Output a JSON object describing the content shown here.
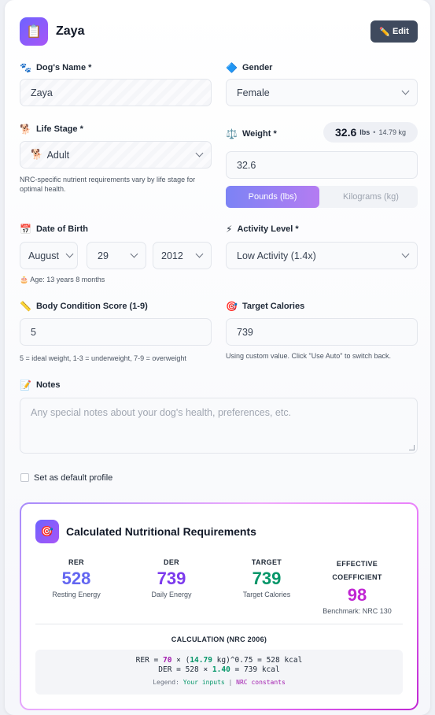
{
  "header": {
    "icon": "clipboard-icon",
    "title": "Zaya",
    "edit_label": "Edit",
    "edit_icon": "pencil-icon"
  },
  "form": {
    "dogs_name": {
      "label": "Dog's Name *",
      "icon": "paw-icon",
      "value": "Zaya"
    },
    "gender": {
      "label": "Gender",
      "icon": "diamond-icon",
      "value": "Female"
    },
    "life_stage": {
      "label": "Life Stage *",
      "icon": "dog-icon",
      "value": "Adult",
      "hint": "NRC-specific nutrient requirements vary by life stage for optimal health."
    },
    "weight": {
      "label": "Weight *",
      "icon": "scale-icon",
      "value": "32.6",
      "badge_value": "32.6",
      "badge_unit": "lbs",
      "badge_sep": "•",
      "badge_kg": "14.79 kg",
      "unit_options": [
        "Pounds (lbs)",
        "Kilograms (kg)"
      ],
      "selected_unit": "Pounds (lbs)"
    },
    "date_of_birth": {
      "label": "Date of Birth",
      "icon": "calendar-icon",
      "month": "August",
      "day": "29",
      "year": "2012",
      "age_text": "Age: 13 years 8 months"
    },
    "activity_level": {
      "label": "Activity Level *",
      "icon": "lightning-icon",
      "value": "Low Activity (1.4x)"
    },
    "body_condition": {
      "label": "Body Condition Score (1-9)",
      "icon": "ruler-icon",
      "value": "5",
      "hint": "5 = ideal weight, 1-3 = underweight, 7-9 = overweight"
    },
    "target_calories": {
      "label": "Target Calories",
      "icon": "target-icon",
      "value": "739",
      "hint": "Using custom value. Click \"Use Auto\" to switch back."
    },
    "notes": {
      "label": "Notes",
      "icon": "memo-icon",
      "placeholder": "Any special notes about your dog's health, preferences, etc."
    },
    "default_profile": {
      "label": "Set as default profile",
      "checked": false
    }
  },
  "results": {
    "title": "Calculated Nutritional Requirements",
    "icon": "target-icon",
    "stats": [
      {
        "key": "RER",
        "value": "528",
        "sub": "Resting Energy",
        "color": "#6366f1"
      },
      {
        "key": "DER",
        "value": "739",
        "sub": "Daily Energy",
        "color": "#7c3aed"
      },
      {
        "key": "TARGET",
        "value": "739",
        "sub": "Target Calories",
        "color": "#059669"
      },
      {
        "key": "EFFECTIVE COEFFICIENT",
        "value": "98",
        "sub": "Benchmark: NRC 130",
        "color": "#c026d3"
      }
    ],
    "calc_heading": "CALCULATION (NRC 2006)",
    "rer_line": {
      "a": "RER = ",
      "const": "70",
      "b": " × (",
      "input": "14.79",
      "c": " kg)^0.75 = 528 kcal"
    },
    "der_line": {
      "a": "DER = 528 × ",
      "input": "1.40",
      "b": " = 739 kcal"
    },
    "legend": {
      "prefix": "Legend: ",
      "inputs": "Your inputs",
      "sep": " | ",
      "constants": "NRC constants"
    }
  }
}
